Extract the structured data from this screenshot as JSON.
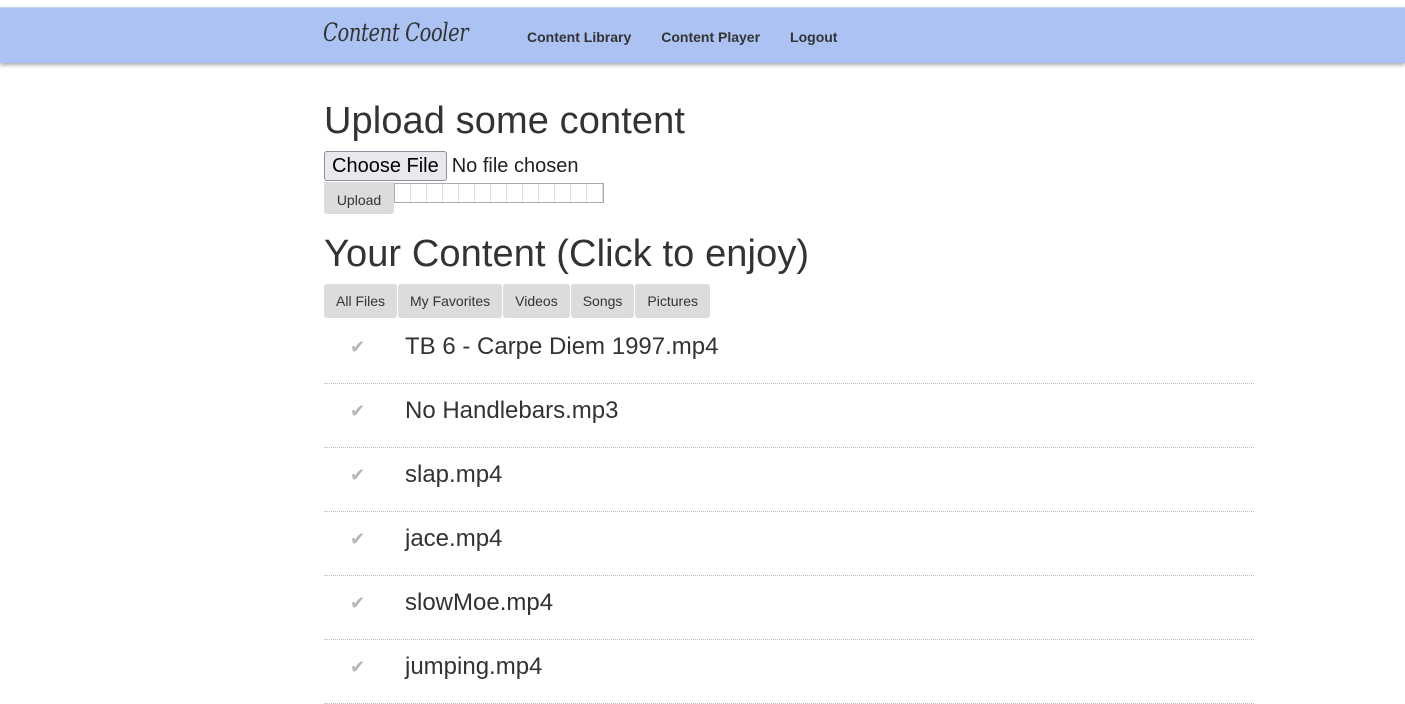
{
  "navbar": {
    "brand": "Content Cooler",
    "links": [
      "Content Library",
      "Content Player",
      "Logout"
    ]
  },
  "upload": {
    "heading": "Upload some content",
    "choose_label": "Choose File",
    "file_status": "No file chosen",
    "upload_label": "Upload",
    "progress": 0
  },
  "content": {
    "heading": "Your Content (Click to enjoy)",
    "tabs": [
      "All Files",
      "My Favorites",
      "Videos",
      "Songs",
      "Pictures"
    ],
    "check_glyph": "✔",
    "files": [
      "TB 6 - Carpe Diem 1997.mp4",
      "No Handlebars.mp3",
      "slap.mp4",
      "jace.mp4",
      "slowMoe.mp4",
      "jumping.mp4"
    ]
  },
  "colors": {
    "navbar": "#abc2f3",
    "button_bg": "#dcdcdc",
    "check": "#b5b5b5"
  },
  "icons": {
    "check": "check-icon"
  }
}
